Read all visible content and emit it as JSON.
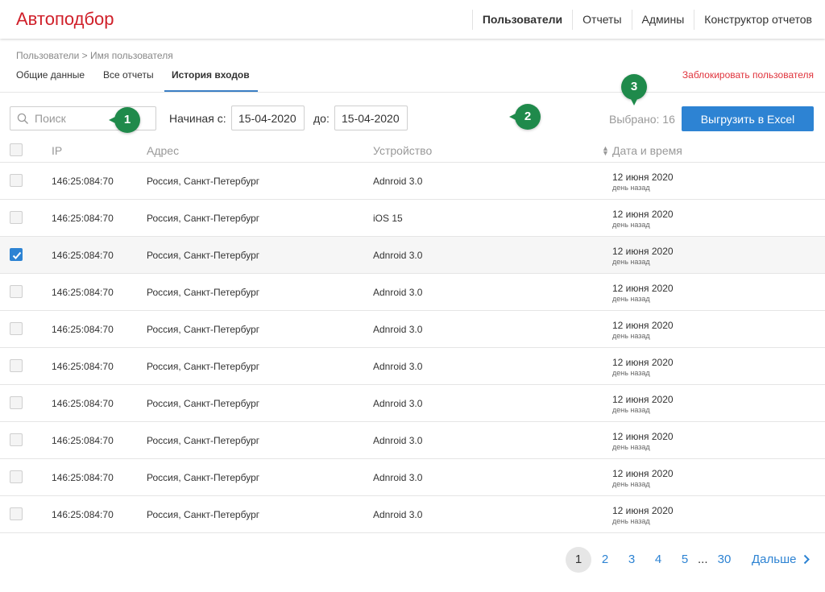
{
  "app": {
    "title": "Автоподбор"
  },
  "topnav": [
    {
      "label": "Пользователи",
      "active": true
    },
    {
      "label": "Отчеты",
      "active": false
    },
    {
      "label": "Админы",
      "active": false
    },
    {
      "label": "Конструктор отчетов",
      "active": false
    }
  ],
  "breadcrumb": "Пользователи > Имя пользователя",
  "tabs": [
    {
      "label": "Общие данные",
      "active": false
    },
    {
      "label": "Все отчеты",
      "active": false
    },
    {
      "label": "История входов",
      "active": true
    }
  ],
  "block_user_link": "Заблокировать пользователя",
  "filters": {
    "search_placeholder": "Поиск",
    "from_label": "Начиная с:",
    "from_value": "15-04-2020",
    "to_label": "до:",
    "to_value": "15-04-2020"
  },
  "selected_count_label": "Выбрано: 16",
  "export_button": "Выгрузить в Excel",
  "markers": [
    "1",
    "2",
    "3"
  ],
  "table": {
    "columns": {
      "ip": "IP",
      "address": "Адрес",
      "device": "Устройство",
      "datetime": "Дата и время"
    },
    "rows": [
      {
        "ip": "146:25:084:70",
        "address": "Россия, Санкт-Петербург",
        "device": "Adnroid 3.0",
        "date": "12 июня 2020",
        "ago": "день назад",
        "checked": false
      },
      {
        "ip": "146:25:084:70",
        "address": "Россия, Санкт-Петербург",
        "device": "iOS 15",
        "date": "12 июня 2020",
        "ago": "день назад",
        "checked": false
      },
      {
        "ip": "146:25:084:70",
        "address": "Россия, Санкт-Петербург",
        "device": "Adnroid 3.0",
        "date": "12 июня 2020",
        "ago": "день назад",
        "checked": true
      },
      {
        "ip": "146:25:084:70",
        "address": "Россия, Санкт-Петербург",
        "device": "Adnroid 3.0",
        "date": "12 июня 2020",
        "ago": "день назад",
        "checked": false
      },
      {
        "ip": "146:25:084:70",
        "address": "Россия, Санкт-Петербург",
        "device": "Adnroid 3.0",
        "date": "12 июня 2020",
        "ago": "день назад",
        "checked": false
      },
      {
        "ip": "146:25:084:70",
        "address": "Россия, Санкт-Петербург",
        "device": "Adnroid 3.0",
        "date": "12 июня 2020",
        "ago": "день назад",
        "checked": false
      },
      {
        "ip": "146:25:084:70",
        "address": "Россия, Санкт-Петербург",
        "device": "Adnroid 3.0",
        "date": "12 июня 2020",
        "ago": "день назад",
        "checked": false
      },
      {
        "ip": "146:25:084:70",
        "address": "Россия, Санкт-Петербург",
        "device": "Adnroid 3.0",
        "date": "12 июня 2020",
        "ago": "день назад",
        "checked": false
      },
      {
        "ip": "146:25:084:70",
        "address": "Россия, Санкт-Петербург",
        "device": "Adnroid 3.0",
        "date": "12 июня 2020",
        "ago": "день назад",
        "checked": false
      },
      {
        "ip": "146:25:084:70",
        "address": "Россия, Санкт-Петербург",
        "device": "Adnroid 3.0",
        "date": "12 июня 2020",
        "ago": "день назад",
        "checked": false
      }
    ]
  },
  "pagination": {
    "pages": [
      "1",
      "2",
      "3",
      "4",
      "5"
    ],
    "current": "1",
    "ellipsis": "...",
    "last": "30",
    "next_label": "Дальше"
  },
  "colors": {
    "brand": "#d0202a",
    "accent": "#2d83d3",
    "marker": "#1f8a4b",
    "danger": "#e0333c"
  }
}
